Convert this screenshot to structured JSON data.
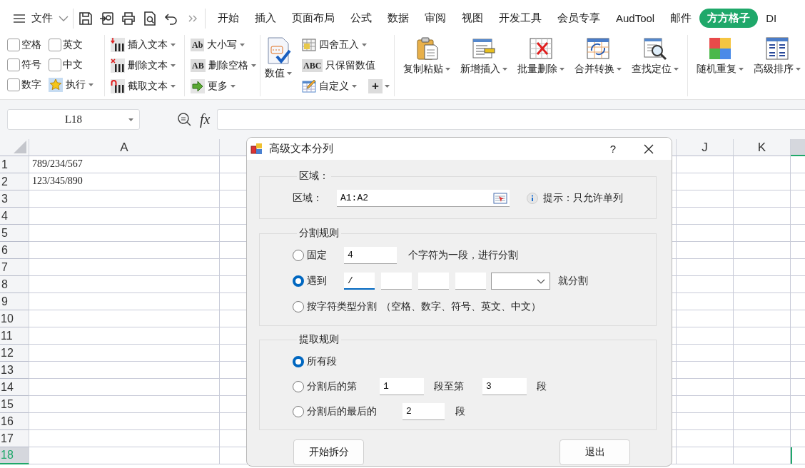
{
  "tabbar": {
    "file_label": "文件",
    "menu_tabs": [
      {
        "label": "开始",
        "selected": false
      },
      {
        "label": "插入",
        "selected": false
      },
      {
        "label": "页面布局",
        "selected": false
      },
      {
        "label": "公式",
        "selected": false
      },
      {
        "label": "数据",
        "selected": false
      },
      {
        "label": "审阅",
        "selected": false
      },
      {
        "label": "视图",
        "selected": false
      },
      {
        "label": "开发工具",
        "selected": false
      },
      {
        "label": "会员专享",
        "selected": false
      },
      {
        "label": "AudTool",
        "selected": false
      },
      {
        "label": "邮件",
        "selected": false
      },
      {
        "label": "方方格子",
        "selected": true
      },
      {
        "label": "DI",
        "selected": false
      }
    ]
  },
  "ribbon": {
    "checkboxes": [
      {
        "label": "空格",
        "checked": false
      },
      {
        "label": "英文",
        "checked": false
      },
      {
        "label": "符号",
        "checked": false
      },
      {
        "label": "中文",
        "checked": false
      },
      {
        "label": "数字",
        "checked": false
      }
    ],
    "run_button": {
      "label": "执行",
      "dropdown": true
    },
    "text_tools": [
      {
        "label": "插入文本",
        "dropdown": true
      },
      {
        "label": "删除文本",
        "dropdown": true
      },
      {
        "label": "截取文本",
        "dropdown": true
      }
    ],
    "format_tools": [
      {
        "label": "大小写",
        "icon_text": "Ab",
        "dropdown": true
      },
      {
        "label": "删除空格",
        "icon_text": "AB",
        "dropdown": true
      },
      {
        "label": "更多",
        "dropdown": true
      }
    ],
    "number_button": {
      "label": "数值",
      "dropdown": true
    },
    "number_tools": [
      {
        "label": "四舍五入",
        "dropdown": true
      },
      {
        "label": "只保留数值",
        "icon_text": "ABC",
        "dropdown": false
      },
      {
        "label": "自定义",
        "dropdown": true
      }
    ],
    "add_button": {
      "label": "+",
      "dropdown": true
    },
    "large_tools": [
      {
        "label": "复制粘贴",
        "dropdown": true
      },
      {
        "label": "新增插入",
        "dropdown": true
      },
      {
        "label": "批量删除",
        "dropdown": true
      },
      {
        "label": "合并转换",
        "dropdown": true
      },
      {
        "label": "查找定位",
        "dropdown": true
      }
    ],
    "large_tools_2": [
      {
        "label": "随机重复",
        "dropdown": true
      },
      {
        "label": "高级排序",
        "dropdown": true
      }
    ]
  },
  "formula_bar": {
    "name_box": "L18",
    "function_label": "fx"
  },
  "sheet": {
    "columns": [
      {
        "label": "A",
        "selected": false
      },
      {
        "label": "J",
        "selected": false
      },
      {
        "label": "K",
        "selected": false
      },
      {
        "selected": true
      }
    ],
    "rows": [
      {
        "number": "1",
        "selected": false,
        "cells": [
          "789/234/567"
        ]
      },
      {
        "number": "2",
        "selected": false,
        "cells": [
          "123/345/890"
        ]
      },
      {
        "number": "3",
        "selected": false
      },
      {
        "number": "4",
        "selected": false
      },
      {
        "number": "5",
        "selected": false
      },
      {
        "number": "6",
        "selected": false
      },
      {
        "number": "7",
        "selected": false
      },
      {
        "number": "8",
        "selected": false
      },
      {
        "number": "9",
        "selected": false
      },
      {
        "number": "10",
        "selected": false
      },
      {
        "number": "11",
        "selected": false
      },
      {
        "number": "12",
        "selected": false
      },
      {
        "number": "13",
        "selected": false
      },
      {
        "number": "14",
        "selected": false
      },
      {
        "number": "15",
        "selected": false
      },
      {
        "number": "16",
        "selected": false
      },
      {
        "number": "17",
        "selected": false
      },
      {
        "number": "18",
        "selected": true
      }
    ]
  },
  "dialog": {
    "title": "高级文本分列",
    "help": "?",
    "region": {
      "legend": "区域：",
      "label": "区域：",
      "value": "A1:A2",
      "hint": "提示：只允许单列"
    },
    "split_rule": {
      "legend": "分割规则",
      "options": [
        {
          "kind": "fixed",
          "label": "固定",
          "selected": false,
          "value": "4",
          "suffix": "个字符为一段，进行分割"
        },
        {
          "kind": "delimiter",
          "label": "遇到",
          "selected": true,
          "fields": [
            {
              "value": "/",
              "focused": true
            },
            {
              "focused": false
            },
            {
              "focused": false
            },
            {
              "focused": false
            }
          ],
          "suffix": "就分割"
        },
        {
          "kind": "type",
          "label": "按字符类型分割",
          "selected": false,
          "note": "（空格、数字、符号、英文、中文）"
        }
      ]
    },
    "extract_rule": {
      "legend": "提取规则",
      "options": [
        {
          "kind": "all",
          "label": "所有段",
          "selected": true
        },
        {
          "kind": "range",
          "label": "分割后的第",
          "selected": false,
          "from": "1",
          "middle": "段至第",
          "to": "3",
          "suffix": "段"
        },
        {
          "kind": "last",
          "label": "分割后的最后的",
          "selected": false,
          "value": "2",
          "suffix": "段"
        }
      ]
    },
    "buttons": [
      "开始拆分",
      "退出"
    ]
  }
}
